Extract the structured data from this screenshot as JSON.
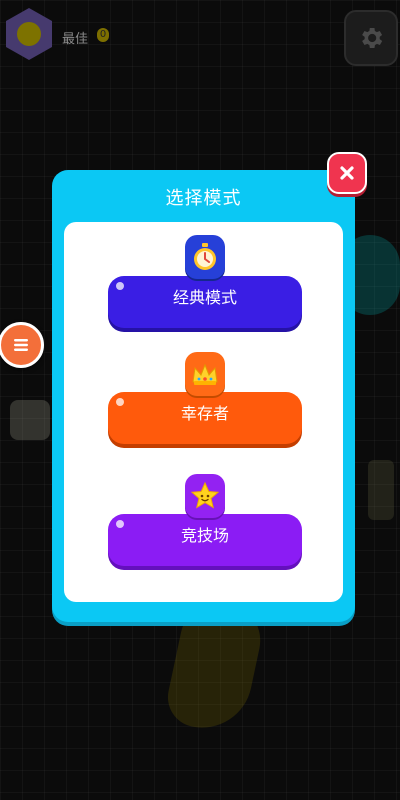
{
  "header": {
    "best_label": "最佳",
    "best_value": "0"
  },
  "dialog": {
    "title": "选择模式",
    "modes": [
      {
        "label": "经典模式",
        "icon": "stopwatch-icon",
        "color": "#3a1ee4"
      },
      {
        "label": "幸存者",
        "icon": "crown-icon",
        "color": "#ff5a0c"
      },
      {
        "label": "竞技场",
        "icon": "star-icon",
        "color": "#8b1cf4"
      }
    ],
    "accent": "#0bc8f4",
    "close_color": "#f0344f"
  }
}
